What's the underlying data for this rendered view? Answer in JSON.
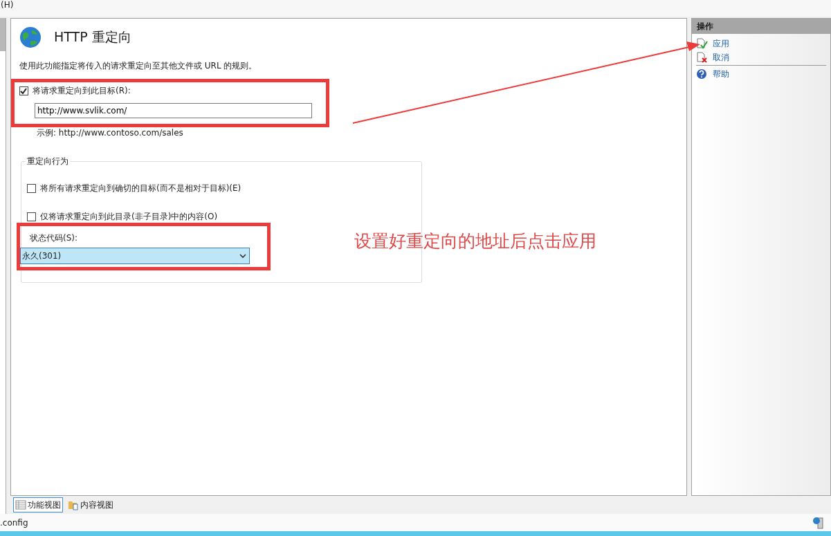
{
  "menu_bar": {
    "item": "(H)"
  },
  "page": {
    "title": "HTTP 重定向",
    "description": "使用此功能指定将传入的请求重定向至其他文件或 URL 的规则。",
    "redirect": {
      "label": "将请求重定向到此目标(R):",
      "checked": true,
      "value": "http://www.svlik.com/",
      "example": "示例: http://www.contoso.com/sales"
    },
    "behavior": {
      "title": "重定向行为",
      "options": [
        {
          "label": "将所有请求重定向到确切的目标(而不是相对于目标)(E)",
          "checked": false
        },
        {
          "label": "仅将请求重定向到此目录(非子目录)中的内容(O)",
          "checked": false
        }
      ],
      "status_code": {
        "label": "状态代码(S):",
        "value": "永久(301)"
      }
    }
  },
  "view_tabs": [
    {
      "label": "功能视图",
      "kind": "features",
      "selected": true
    },
    {
      "label": "内容视图",
      "kind": "content",
      "selected": false
    }
  ],
  "actions": {
    "title": "操作",
    "items": [
      {
        "label": "应用",
        "kind": "apply"
      },
      {
        "label": "取消",
        "kind": "cancel"
      },
      {
        "label": "帮助",
        "kind": "help"
      }
    ]
  },
  "status_bar": {
    "text": ".config"
  },
  "annotation": {
    "text": "设置好重定向的地址后点击应用"
  }
}
